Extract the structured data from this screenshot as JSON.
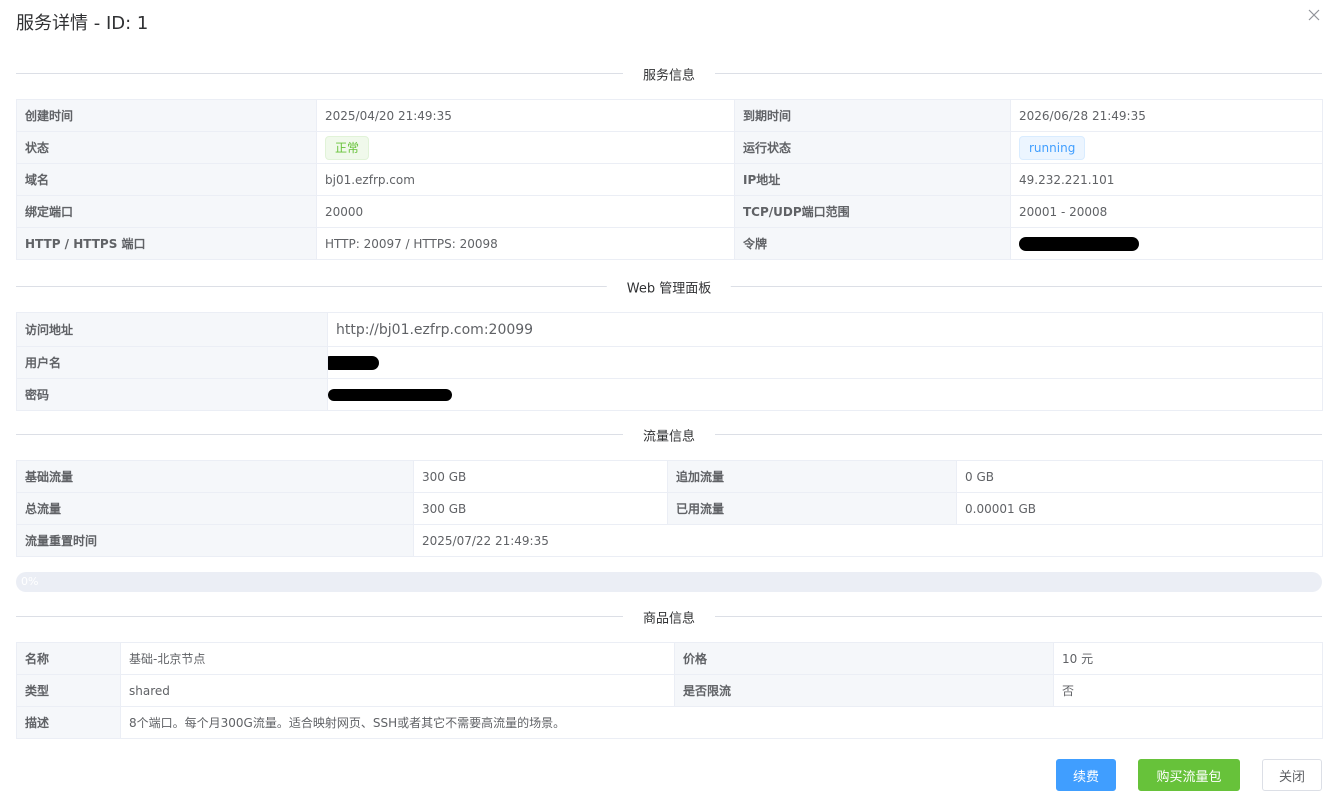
{
  "dialog": {
    "title": "服务详情 - ID: 1"
  },
  "sections": {
    "service": "服务信息",
    "web": "Web 管理面板",
    "traffic": "流量信息",
    "product": "商品信息"
  },
  "service_info": {
    "created_label": "创建时间",
    "created_value": "2025/04/20 21:49:35",
    "expire_label": "到期时间",
    "expire_value": "2026/06/28 21:49:35",
    "status_label": "状态",
    "status_value": "正常",
    "run_label": "运行状态",
    "run_value": "running",
    "domain_label": "域名",
    "domain_value": "bj01.ezfrp.com",
    "ip_label": "IP地址",
    "ip_value": "49.232.221.101",
    "port_label": "绑定端口",
    "port_value": "20000",
    "range_label": "TCP/UDP端口范围",
    "range_value": "20001 - 20008",
    "http_label": "HTTP / HTTPS 端口",
    "http_value": "HTTP: 20097 / HTTPS: 20098",
    "token_label": "令牌"
  },
  "web_panel": {
    "url_label": "访问地址",
    "url_value": "http://bj01.ezfrp.com:20099",
    "user_label": "用户名",
    "pass_label": "密码"
  },
  "traffic": {
    "base_label": "基础流量",
    "base_value": "300 GB",
    "extra_label": "追加流量",
    "extra_value": "0 GB",
    "total_label": "总流量",
    "total_value": "300 GB",
    "used_label": "已用流量",
    "used_value": "0.00001 GB",
    "reset_label": "流量重置时间",
    "reset_value": "2025/07/22 21:49:35",
    "progress_text": "0%",
    "progress_percent": 0
  },
  "product": {
    "name_label": "名称",
    "name_value": "基础-北京节点",
    "price_label": "价格",
    "price_value": "10 元",
    "type_label": "类型",
    "type_value": "shared",
    "limit_label": "是否限流",
    "limit_value": "否",
    "desc_label": "描述",
    "desc_value": "8个端口。每个月300G流量。适合映射网页、SSH或者其它不需要高流量的场景。"
  },
  "buttons": {
    "renew": "续费",
    "buy_traffic": "购买流量包",
    "close": "关闭"
  },
  "colors": {
    "primary": "#409eff",
    "success": "#67c23a",
    "label_bg": "#f5f7fa",
    "border": "#ebeef5"
  },
  "icons": {
    "close": "close-icon"
  }
}
